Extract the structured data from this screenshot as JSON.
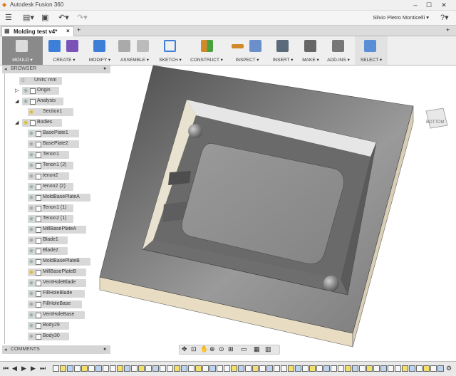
{
  "window": {
    "title": "Autodesk Fusion 360"
  },
  "user": {
    "name": "Silvio Pietro Monticelli ▾"
  },
  "tab": {
    "label": "Molding test v4*",
    "close": "×"
  },
  "ribbon": [
    {
      "label": "MOULD ▾",
      "color": "#ffffff"
    },
    {
      "label": "CREATE ▾",
      "color": "#3d7fd6"
    },
    {
      "label": "MODIFY ▾",
      "color": "#3d7fd6"
    },
    {
      "label": "ASSEMBLE ▾",
      "color": "#888888"
    },
    {
      "label": "SKETCH ▾",
      "color": "#3d7fd6"
    },
    {
      "label": "CONSTRUCT ▾",
      "color": "#d08a2a"
    },
    {
      "label": "INSPECT ▾",
      "color": "#d08a2a"
    },
    {
      "label": "INSERT ▾",
      "color": "#444444"
    },
    {
      "label": "MAKE ▾",
      "color": "#555555"
    },
    {
      "label": "ADD-INS ▾",
      "color": "#555555"
    },
    {
      "label": "SELECT ▾",
      "color": "#4aa13b"
    }
  ],
  "browser": {
    "title": "BROWSER",
    "units": "Units: mm",
    "origin": "Origin",
    "analysis": "Analysis",
    "section": "Section1",
    "bodies": "Bodies",
    "items": [
      "BasePlate1",
      "BasePlate2",
      "Tenon1",
      "Tenon1 (2)",
      "tenon2",
      "tenon2 (2)",
      "MoldBasePlateA",
      "Tenon1 (1)",
      "Tenon2 (1)",
      "MillBasePlateA",
      "Blade1",
      "Blade2",
      "MoldBasePlateB",
      "MillBasePlateB",
      "VentHoleBlade",
      "FillHoleBlade",
      "FillHoleBase",
      "VentHoleBase",
      "Body29",
      "Body30"
    ]
  },
  "comments": {
    "title": "COMMENTS"
  },
  "viewcube": {
    "label": "BOTTOM"
  }
}
